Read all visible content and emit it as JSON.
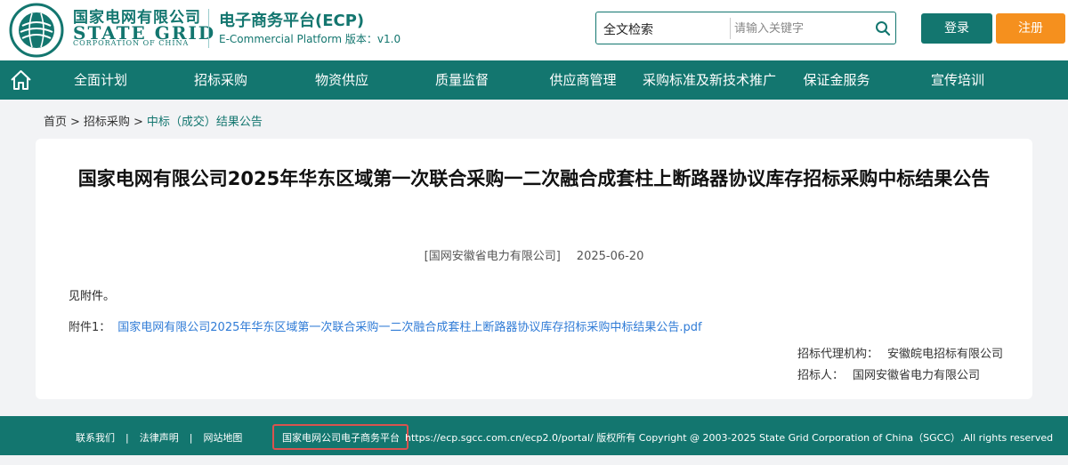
{
  "header": {
    "logo_cn": "国家电网有限公司",
    "logo_en": "STATE GRID",
    "logo_en_small": "CORPORATION OF CHINA",
    "ecp_title": "电子商务平台(ECP)",
    "ecp_sub": "E-Commercial Platform 版本：v1.0",
    "search": {
      "type_label": "全文检索",
      "placeholder": "请输入关键字"
    },
    "login_label": "登录",
    "register_label": "注册"
  },
  "nav": {
    "items": [
      "全面计划",
      "招标采购",
      "物资供应",
      "质量监督",
      "供应商管理",
      "采购标准及新技术推广",
      "保证金服务",
      "宣传培训"
    ]
  },
  "breadcrumb": {
    "home": "首页",
    "level1": "招标采购",
    "current": "中标（成交）结果公告"
  },
  "article": {
    "title": "国家电网有限公司2025年华东区域第一次联合采购一二次融合成套柱上断路器协议库存招标采购中标结果公告",
    "source": "[国网安徽省电力有限公司]",
    "date": "2025-06-20",
    "body": "见附件。",
    "attachment_label": "附件1：",
    "attachment_name": "国家电网有限公司2025年华东区域第一次联合采购一二次融合成套柱上断路器协议库存招标采购中标结果公告.pdf",
    "agency_label": "招标代理机构：",
    "agency_name": "安徽皖电招标有限公司",
    "tenderer_label": "招标人：",
    "tenderer_name": "国网安徽省电力有限公司"
  },
  "footer": {
    "links": [
      "联系我们",
      "法律声明",
      "网站地图"
    ],
    "link_sep": "|",
    "platform": "国家电网公司电子商务平台",
    "copyright": "https://ecp.sgcc.com.cn/ecp2.0/portal/ 版权所有 Copyright @ 2003-2025 State Grid Corporation of China（SGCC）.All rights reserved"
  },
  "colors": {
    "brand": "#13766f",
    "register": "#f5901e",
    "link": "#2f7bd6",
    "highlight": "#d9534f"
  },
  "icons": [
    "state-grid-emblem-icon",
    "search-icon",
    "home-icon"
  ]
}
